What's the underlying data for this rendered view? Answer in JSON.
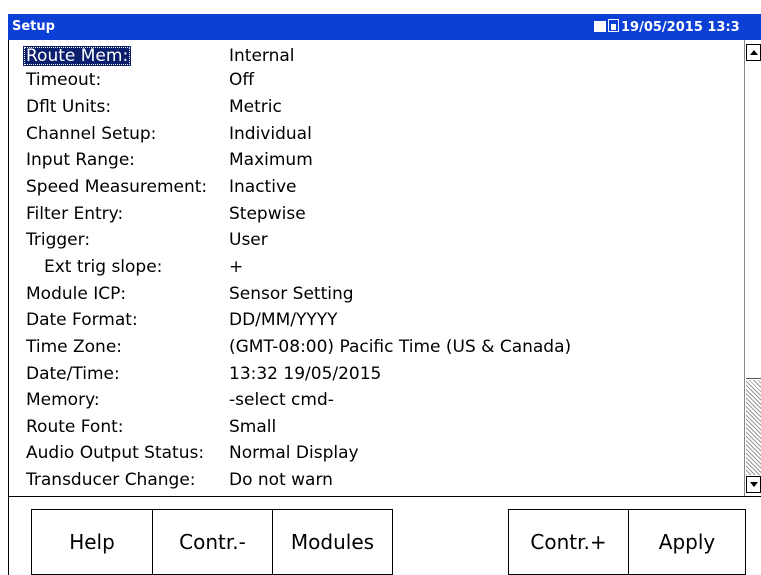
{
  "window": {
    "title": "Setup",
    "datetime": "19/05/2015 13:3",
    "status_icons": [
      "memory-card-icon",
      "battery-icon"
    ]
  },
  "settings": [
    {
      "label": "Route Mem:",
      "value": "Internal",
      "selected": true
    },
    {
      "label": "Timeout:",
      "value": "Off"
    },
    {
      "label": "Dflt Units:",
      "value": "Metric"
    },
    {
      "label": "Channel Setup:",
      "value": "Individual"
    },
    {
      "label": "Input Range:",
      "value": "Maximum"
    },
    {
      "label": "Speed Measurement:",
      "value": "Inactive"
    },
    {
      "label": "Filter Entry:",
      "value": "Stepwise"
    },
    {
      "label": "Trigger:",
      "value": "User"
    },
    {
      "label": "Ext trig slope:",
      "value": "+",
      "indented": true
    },
    {
      "label": "Module ICP:",
      "value": "Sensor Setting"
    },
    {
      "label": "Date Format:",
      "value": "DD/MM/YYYY"
    },
    {
      "label": "Time Zone:",
      "value": "(GMT-08:00) Pacific Time (US & Canada)"
    },
    {
      "label": "Date/Time:",
      "value": "13:32 19/05/2015"
    },
    {
      "label": "Memory:",
      "value": "-select cmd-"
    },
    {
      "label": "Route Font:",
      "value": "Small"
    },
    {
      "label": "Audio Output Status:",
      "value": "Normal Display"
    },
    {
      "label": "Transducer Change:",
      "value": "Do not warn"
    }
  ],
  "buttons": {
    "help": "Help",
    "contr_minus": "Contr.-",
    "modules": "Modules",
    "contr_plus": "Contr.+",
    "apply": "Apply"
  }
}
